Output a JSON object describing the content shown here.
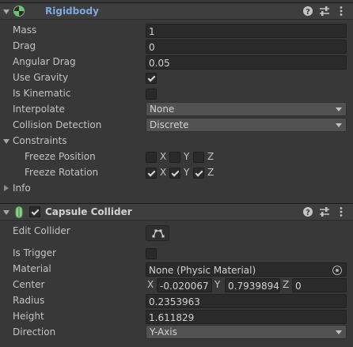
{
  "rigidbody": {
    "title": "Rigidbody",
    "fields": {
      "mass": {
        "label": "Mass",
        "value": "1"
      },
      "drag": {
        "label": "Drag",
        "value": "0"
      },
      "angular_drag": {
        "label": "Angular Drag",
        "value": "0.05"
      },
      "use_gravity": {
        "label": "Use Gravity",
        "checked": true
      },
      "is_kinematic": {
        "label": "Is Kinematic",
        "checked": false
      },
      "interpolate": {
        "label": "Interpolate",
        "value": "None"
      },
      "collision_detection": {
        "label": "Collision Detection",
        "value": "Discrete"
      }
    },
    "constraints": {
      "label": "Constraints",
      "freeze_position": {
        "label": "Freeze Position",
        "x": false,
        "y": false,
        "z": false,
        "x_label": "X",
        "y_label": "Y",
        "z_label": "Z"
      },
      "freeze_rotation": {
        "label": "Freeze Rotation",
        "x": true,
        "y": true,
        "z": true,
        "x_label": "X",
        "y_label": "Y",
        "z_label": "Z"
      }
    },
    "info_label": "Info",
    "header_icons": [
      "help-icon",
      "sliders-icon",
      "more-icon"
    ]
  },
  "capsule_collider": {
    "title": "Capsule Collider",
    "enabled": true,
    "fields": {
      "edit_collider": {
        "label": "Edit Collider"
      },
      "is_trigger": {
        "label": "Is Trigger",
        "checked": false
      },
      "material": {
        "label": "Material",
        "value": "None (Physic Material)"
      },
      "center": {
        "label": "Center",
        "x_label": "X",
        "x": "-0.020067",
        "y_label": "Y",
        "y": "0.7939894",
        "z_label": "Z",
        "z": "0"
      },
      "radius": {
        "label": "Radius",
        "value": "0.2353963"
      },
      "height": {
        "label": "Height",
        "value": "1.611829"
      },
      "direction": {
        "label": "Direction",
        "value": "Y-Axis"
      }
    },
    "header_icons": [
      "help-icon",
      "sliders-icon",
      "more-icon"
    ]
  },
  "colors": {
    "background": "#383838",
    "header": "#3e3e3e",
    "rigidbody_title": "#7fa7e0",
    "capsule_icon": "#8fd18f",
    "field": "#2a2a2a",
    "dropdown": "#515151"
  }
}
